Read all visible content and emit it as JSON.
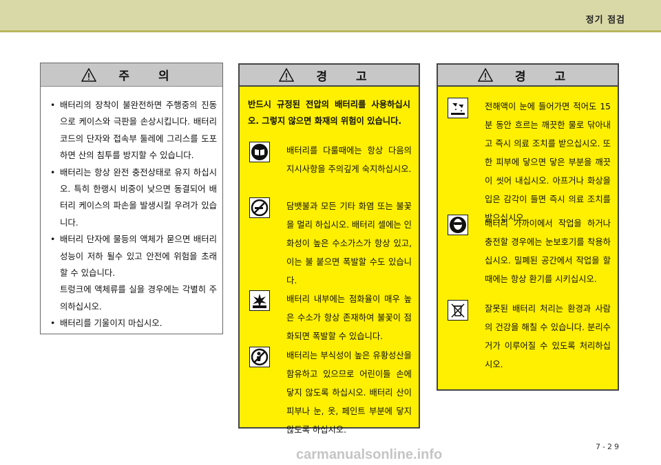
{
  "header": {
    "title": "정기 점검"
  },
  "caution": {
    "title": "주 의",
    "items": [
      "배터리의 장착이 불완전하면 주행중의 진동으로 케이스와 극판을 손상시킵니다. 배터리 코드의 단자와 접속부 둘레에 그리스를 도포하면 산의 침투를 방지할 수 있습니다.",
      "배터리는 항상 완전 충전상태로 유지 하십시오. 특히 한랭시 비중이 낮으면 동결되어 배터리 케이스의 파손을 발생시킬 우려가 있습니다.",
      "배터리 단자에 물등의 액체가 묻으면 배터리 성능이 저하 될수 있고 안전에 위험을 초래할 수 있습니다.",
      "트렁크에 액체류를 실을 경우에는 각별히 주의하십시오.",
      "배터리를 기울이지 마십시오."
    ]
  },
  "warning1": {
    "title": "경 고",
    "intro": "반드시 규정된 전압의 배터리를 사용하십시오. 그렇지 않으면 화재의 위험이 있습니다.",
    "items": [
      {
        "icon": "manual-book-icon",
        "text": "배터리를 다룰때에는 항상 다음의 지시사항을 주의깊게 숙지하십시오."
      },
      {
        "icon": "no-smoking-icon",
        "text": "담뱃불과 모든 기타 화염 또는 불꽃을 멀리 하십시오. 배터리 셀에는 인화성이 높은 수소가스가 항상 있고, 이는 불 붙으면 폭발할 수도 있습니다."
      },
      {
        "icon": "explosion-icon",
        "text": "배터리 내부에는 점화율이 매우 높은 수소가 항상 존재하여 불꽃이 점화되면 폭발할 수 있습니다."
      },
      {
        "icon": "keep-away-children-icon",
        "text": "배터리는 부식성이 높은 유황성산을 함유하고 있으므로 어린이들 손에 닿지 않도록 하십시오. 배터리 산이 피부나 눈, 옷, 페인트 부분에 닿지 않도록 하십시오."
      }
    ]
  },
  "warning2": {
    "title": "경 고",
    "items": [
      {
        "icon": "acid-burn-icon",
        "text": "전해액이 눈에 들어가면 적어도 15분 동안 흐르는 깨끗한 물로 닦아내고 즉시 의료 조치를 받으십시오. 또한 피부에 닿으면 닿은 부분을 깨끗이 씻어 내십시오. 아프거나 화상을 입은 감각이 들면 즉시 의료 조치를 받으십시오."
      },
      {
        "icon": "eye-protection-icon",
        "text": "배터리 가까이에서 작업을 하거나 충전할 경우에는 눈보호기를 착용하십시오. 밀폐된 공간에서 작업을 할때에는 항상 환기를 시키십시오."
      },
      {
        "icon": "recycle-bin-icon",
        "text": "잘못된 배터리 처리는 환경과 사람의 건강을 해칠 수 있습니다. 분리수거가 이루어질 수 있도록 처리하십시오."
      }
    ]
  },
  "page": {
    "number": "7-29"
  },
  "watermark": "carmanualsonline.info",
  "colors": {
    "warning_bg": "#fef000",
    "header_bar": "#d9d9a8",
    "panel_head": "#c7c7c7"
  }
}
